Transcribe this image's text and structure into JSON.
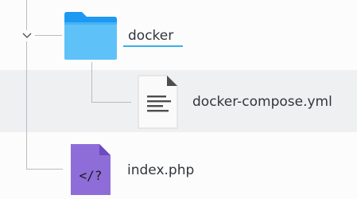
{
  "tree": {
    "nodes": [
      {
        "label": "docker",
        "icon": "folder-icon",
        "expanded": true,
        "children": [
          {
            "label": "docker-compose.yml",
            "icon": "text-file-icon"
          }
        ]
      },
      {
        "label": "index.php",
        "icon": "php-file-icon"
      }
    ]
  },
  "colors": {
    "folder": "#1d99f3",
    "folder_light": "#5ec2f8",
    "php_file": "#8e6dd8",
    "text_file": "#fafafa",
    "accent": "#3daee9",
    "row_highlight": "#eff0f1"
  }
}
